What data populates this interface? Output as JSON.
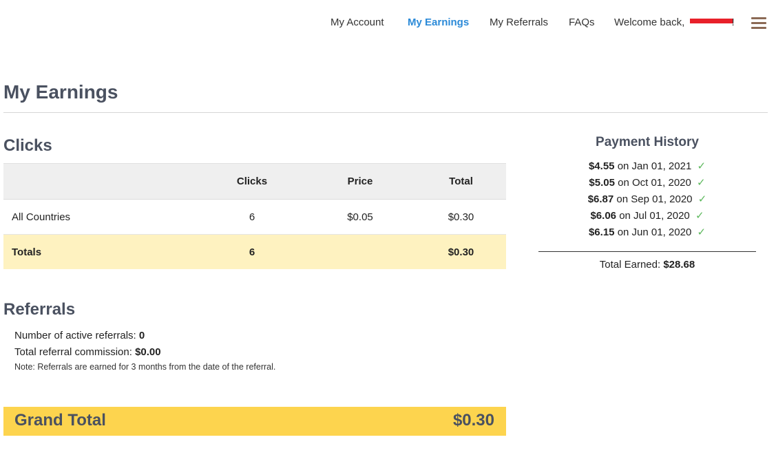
{
  "nav": {
    "items": [
      {
        "label": "My Account"
      },
      {
        "label": "My Earnings",
        "active": true
      },
      {
        "label": "My Referrals"
      },
      {
        "label": "FAQs"
      }
    ],
    "welcome_prefix": "Welcome back, ",
    "welcome_suffix": "!",
    "menu_icon": "hamburger-menu-icon"
  },
  "page": {
    "title": "My Earnings"
  },
  "clicks": {
    "heading": "Clicks",
    "columns": [
      "",
      "Clicks",
      "Price",
      "Total"
    ],
    "rows": [
      {
        "name": "All Countries",
        "clicks": "6",
        "price": "$0.05",
        "total": "$0.30"
      }
    ],
    "totals": {
      "name": "Totals",
      "clicks": "6",
      "price": "",
      "total": "$0.30"
    }
  },
  "referrals": {
    "heading": "Referrals",
    "active_label": "Number of active referrals:",
    "active_value": "0",
    "commission_label": "Total referral commission:",
    "commission_value": "$0.00",
    "note": "Note: Referrals are earned for 3 months from the date of the referral."
  },
  "grand_total": {
    "label": "Grand Total",
    "value": "$0.30"
  },
  "payment_history": {
    "title": "Payment History",
    "entries": [
      {
        "amount": "$4.55",
        "date_text": "on Jan 01, 2021"
      },
      {
        "amount": "$5.05",
        "date_text": "on Oct 01, 2020"
      },
      {
        "amount": "$6.87",
        "date_text": "on Sep 01, 2020"
      },
      {
        "amount": "$6.06",
        "date_text": "on Jul 01, 2020"
      },
      {
        "amount": "$6.15",
        "date_text": "on Jun 01, 2020"
      }
    ],
    "check_glyph": "✓",
    "total_label": "Total Earned:",
    "total_value": "$28.68"
  },
  "colors": {
    "accent": "#2b8ad8",
    "heading": "#4a5160",
    "grand_total_bg": "#fdd44e",
    "totals_row_bg": "#fef2c0",
    "check": "#5cb85c",
    "redaction": "#e8202a"
  }
}
